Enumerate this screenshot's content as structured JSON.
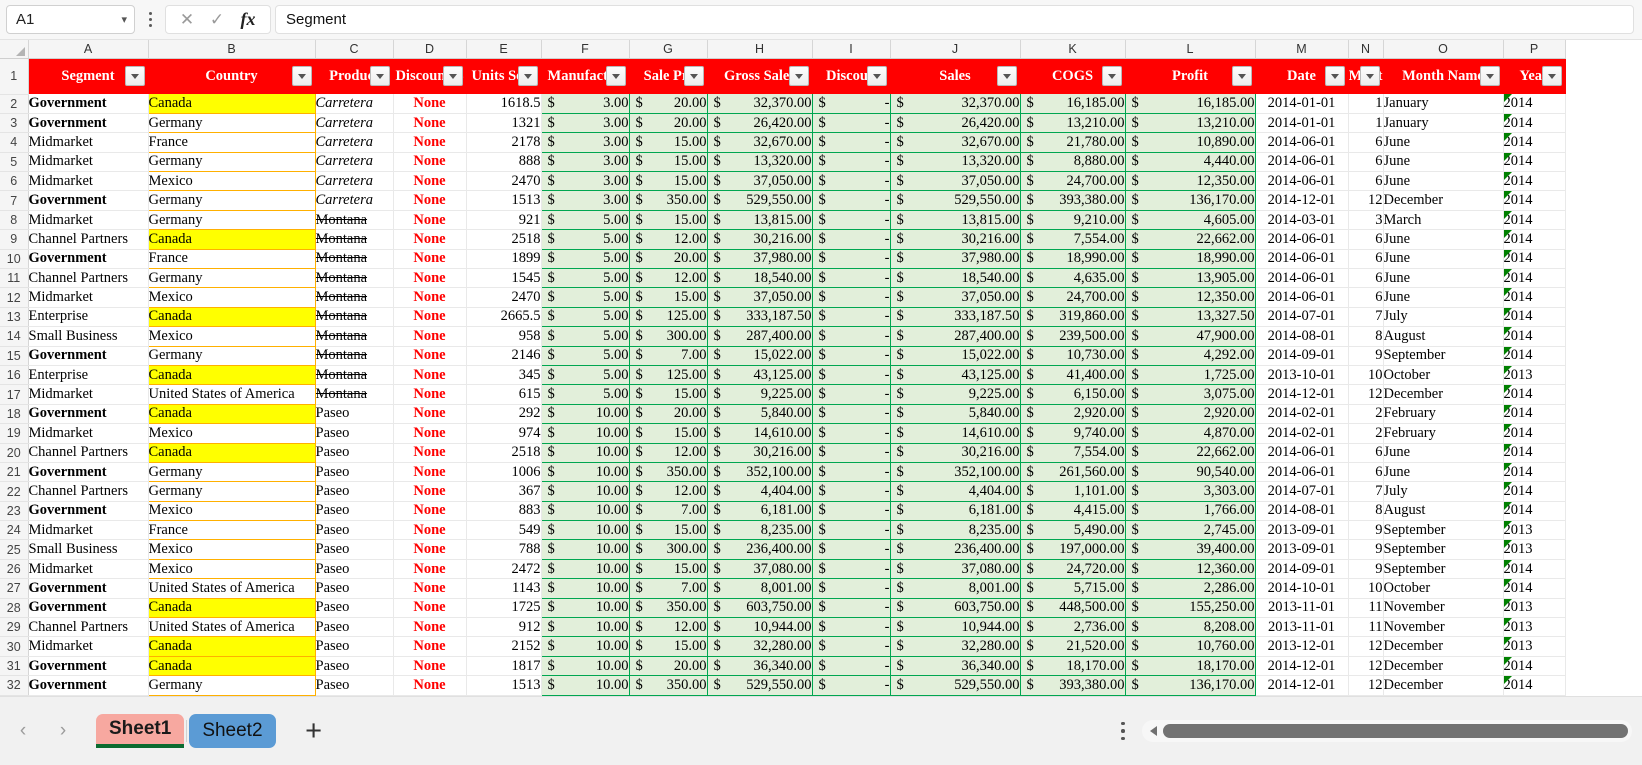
{
  "toolbar": {
    "namebox_value": "A1",
    "namebox_caret": "˅",
    "cancel_icon": "✕",
    "confirm_icon": "✓",
    "fx_label": "fx",
    "formula_value": "Segment"
  },
  "grid": {
    "column_letters": [
      "A",
      "B",
      "C",
      "D",
      "E",
      "F",
      "G",
      "H",
      "I",
      "J",
      "K",
      "L",
      "M",
      "N",
      "O",
      "P"
    ],
    "headers": [
      "Segment",
      "Country",
      "Product",
      "Discount B",
      "Units Sold",
      "Manufactur",
      "Sale Pri",
      "Gross Sales",
      "Discoun",
      "Sales",
      "COGS",
      "Profit",
      "Date",
      "Mont",
      "Month Name",
      "Year"
    ],
    "row_numbers": [
      1,
      2,
      3,
      4,
      5,
      6,
      7,
      8,
      9,
      10,
      11,
      12,
      13,
      14,
      15,
      16,
      17,
      18,
      19,
      20,
      21,
      22,
      23,
      24,
      25,
      26,
      27,
      28,
      29,
      30,
      31,
      32
    ],
    "currency_symbol": "$",
    "dash": "-",
    "rows": [
      {
        "n": 2,
        "segment": "Government",
        "country": "Canada",
        "product": "Carretera",
        "discount": "None",
        "units": "1618.5",
        "mfg": "3.00",
        "sale": "20.00",
        "gross": "32,370.00",
        "disc": "-",
        "sales": "32,370.00",
        "cogs": "16,185.00",
        "profit": "16,185.00",
        "date": "2014-01-01",
        "month": "1",
        "monthname": "January",
        "year": "2014"
      },
      {
        "n": 3,
        "segment": "Government",
        "country": "Germany",
        "product": "Carretera",
        "discount": "None",
        "units": "1321",
        "mfg": "3.00",
        "sale": "20.00",
        "gross": "26,420.00",
        "disc": "-",
        "sales": "26,420.00",
        "cogs": "13,210.00",
        "profit": "13,210.00",
        "date": "2014-01-01",
        "month": "1",
        "monthname": "January",
        "year": "2014"
      },
      {
        "n": 4,
        "segment": "Midmarket",
        "country": "France",
        "product": "Carretera",
        "discount": "None",
        "units": "2178",
        "mfg": "3.00",
        "sale": "15.00",
        "gross": "32,670.00",
        "disc": "-",
        "sales": "32,670.00",
        "cogs": "21,780.00",
        "profit": "10,890.00",
        "date": "2014-06-01",
        "month": "6",
        "monthname": "June",
        "year": "2014"
      },
      {
        "n": 5,
        "segment": "Midmarket",
        "country": "Germany",
        "product": "Carretera",
        "discount": "None",
        "units": "888",
        "mfg": "3.00",
        "sale": "15.00",
        "gross": "13,320.00",
        "disc": "-",
        "sales": "13,320.00",
        "cogs": "8,880.00",
        "profit": "4,440.00",
        "date": "2014-06-01",
        "month": "6",
        "monthname": "June",
        "year": "2014"
      },
      {
        "n": 6,
        "segment": "Midmarket",
        "country": "Mexico",
        "product": "Carretera",
        "discount": "None",
        "units": "2470",
        "mfg": "3.00",
        "sale": "15.00",
        "gross": "37,050.00",
        "disc": "-",
        "sales": "37,050.00",
        "cogs": "24,700.00",
        "profit": "12,350.00",
        "date": "2014-06-01",
        "month": "6",
        "monthname": "June",
        "year": "2014"
      },
      {
        "n": 7,
        "segment": "Government",
        "country": "Germany",
        "product": "Carretera",
        "discount": "None",
        "units": "1513",
        "mfg": "3.00",
        "sale": "350.00",
        "gross": "529,550.00",
        "disc": "-",
        "sales": "529,550.00",
        "cogs": "393,380.00",
        "profit": "136,170.00",
        "date": "2014-12-01",
        "month": "12",
        "monthname": "December",
        "year": "2014"
      },
      {
        "n": 8,
        "segment": "Midmarket",
        "country": "Germany",
        "product": "Montana",
        "discount": "None",
        "units": "921",
        "mfg": "5.00",
        "sale": "15.00",
        "gross": "13,815.00",
        "disc": "-",
        "sales": "13,815.00",
        "cogs": "9,210.00",
        "profit": "4,605.00",
        "date": "2014-03-01",
        "month": "3",
        "monthname": "March",
        "year": "2014"
      },
      {
        "n": 9,
        "segment": "Channel Partners",
        "country": "Canada",
        "product": "Montana",
        "discount": "None",
        "units": "2518",
        "mfg": "5.00",
        "sale": "12.00",
        "gross": "30,216.00",
        "disc": "-",
        "sales": "30,216.00",
        "cogs": "7,554.00",
        "profit": "22,662.00",
        "date": "2014-06-01",
        "month": "6",
        "monthname": "June",
        "year": "2014"
      },
      {
        "n": 10,
        "segment": "Government",
        "country": "France",
        "product": "Montana",
        "discount": "None",
        "units": "1899",
        "mfg": "5.00",
        "sale": "20.00",
        "gross": "37,980.00",
        "disc": "-",
        "sales": "37,980.00",
        "cogs": "18,990.00",
        "profit": "18,990.00",
        "date": "2014-06-01",
        "month": "6",
        "monthname": "June",
        "year": "2014"
      },
      {
        "n": 11,
        "segment": "Channel Partners",
        "country": "Germany",
        "product": "Montana",
        "discount": "None",
        "units": "1545",
        "mfg": "5.00",
        "sale": "12.00",
        "gross": "18,540.00",
        "disc": "-",
        "sales": "18,540.00",
        "cogs": "4,635.00",
        "profit": "13,905.00",
        "date": "2014-06-01",
        "month": "6",
        "monthname": "June",
        "year": "2014"
      },
      {
        "n": 12,
        "segment": "Midmarket",
        "country": "Mexico",
        "product": "Montana",
        "discount": "None",
        "units": "2470",
        "mfg": "5.00",
        "sale": "15.00",
        "gross": "37,050.00",
        "disc": "-",
        "sales": "37,050.00",
        "cogs": "24,700.00",
        "profit": "12,350.00",
        "date": "2014-06-01",
        "month": "6",
        "monthname": "June",
        "year": "2014"
      },
      {
        "n": 13,
        "segment": "Enterprise",
        "country": "Canada",
        "product": "Montana",
        "discount": "None",
        "units": "2665.5",
        "mfg": "5.00",
        "sale": "125.00",
        "gross": "333,187.50",
        "disc": "-",
        "sales": "333,187.50",
        "cogs": "319,860.00",
        "profit": "13,327.50",
        "date": "2014-07-01",
        "month": "7",
        "monthname": "July",
        "year": "2014"
      },
      {
        "n": 14,
        "segment": "Small Business",
        "country": "Mexico",
        "product": "Montana",
        "discount": "None",
        "units": "958",
        "mfg": "5.00",
        "sale": "300.00",
        "gross": "287,400.00",
        "disc": "-",
        "sales": "287,400.00",
        "cogs": "239,500.00",
        "profit": "47,900.00",
        "date": "2014-08-01",
        "month": "8",
        "monthname": "August",
        "year": "2014"
      },
      {
        "n": 15,
        "segment": "Government",
        "country": "Germany",
        "product": "Montana",
        "discount": "None",
        "units": "2146",
        "mfg": "5.00",
        "sale": "7.00",
        "gross": "15,022.00",
        "disc": "-",
        "sales": "15,022.00",
        "cogs": "10,730.00",
        "profit": "4,292.00",
        "date": "2014-09-01",
        "month": "9",
        "monthname": "September",
        "year": "2014"
      },
      {
        "n": 16,
        "segment": "Enterprise",
        "country": "Canada",
        "product": "Montana",
        "discount": "None",
        "units": "345",
        "mfg": "5.00",
        "sale": "125.00",
        "gross": "43,125.00",
        "disc": "-",
        "sales": "43,125.00",
        "cogs": "41,400.00",
        "profit": "1,725.00",
        "date": "2013-10-01",
        "month": "10",
        "monthname": "October",
        "year": "2013"
      },
      {
        "n": 17,
        "segment": "Midmarket",
        "country": "United States of America",
        "product": "Montana",
        "discount": "None",
        "units": "615",
        "mfg": "5.00",
        "sale": "15.00",
        "gross": "9,225.00",
        "disc": "-",
        "sales": "9,225.00",
        "cogs": "6,150.00",
        "profit": "3,075.00",
        "date": "2014-12-01",
        "month": "12",
        "monthname": "December",
        "year": "2014"
      },
      {
        "n": 18,
        "segment": "Government",
        "country": "Canada",
        "product": "Paseo",
        "discount": "None",
        "units": "292",
        "mfg": "10.00",
        "sale": "20.00",
        "gross": "5,840.00",
        "disc": "-",
        "sales": "5,840.00",
        "cogs": "2,920.00",
        "profit": "2,920.00",
        "date": "2014-02-01",
        "month": "2",
        "monthname": "February",
        "year": "2014"
      },
      {
        "n": 19,
        "segment": "Midmarket",
        "country": "Mexico",
        "product": "Paseo",
        "discount": "None",
        "units": "974",
        "mfg": "10.00",
        "sale": "15.00",
        "gross": "14,610.00",
        "disc": "-",
        "sales": "14,610.00",
        "cogs": "9,740.00",
        "profit": "4,870.00",
        "date": "2014-02-01",
        "month": "2",
        "monthname": "February",
        "year": "2014"
      },
      {
        "n": 20,
        "segment": "Channel Partners",
        "country": "Canada",
        "product": "Paseo",
        "discount": "None",
        "units": "2518",
        "mfg": "10.00",
        "sale": "12.00",
        "gross": "30,216.00",
        "disc": "-",
        "sales": "30,216.00",
        "cogs": "7,554.00",
        "profit": "22,662.00",
        "date": "2014-06-01",
        "month": "6",
        "monthname": "June",
        "year": "2014"
      },
      {
        "n": 21,
        "segment": "Government",
        "country": "Germany",
        "product": "Paseo",
        "discount": "None",
        "units": "1006",
        "mfg": "10.00",
        "sale": "350.00",
        "gross": "352,100.00",
        "disc": "-",
        "sales": "352,100.00",
        "cogs": "261,560.00",
        "profit": "90,540.00",
        "date": "2014-06-01",
        "month": "6",
        "monthname": "June",
        "year": "2014"
      },
      {
        "n": 22,
        "segment": "Channel Partners",
        "country": "Germany",
        "product": "Paseo",
        "discount": "None",
        "units": "367",
        "mfg": "10.00",
        "sale": "12.00",
        "gross": "4,404.00",
        "disc": "-",
        "sales": "4,404.00",
        "cogs": "1,101.00",
        "profit": "3,303.00",
        "date": "2014-07-01",
        "month": "7",
        "monthname": "July",
        "year": "2014"
      },
      {
        "n": 23,
        "segment": "Government",
        "country": "Mexico",
        "product": "Paseo",
        "discount": "None",
        "units": "883",
        "mfg": "10.00",
        "sale": "7.00",
        "gross": "6,181.00",
        "disc": "-",
        "sales": "6,181.00",
        "cogs": "4,415.00",
        "profit": "1,766.00",
        "date": "2014-08-01",
        "month": "8",
        "monthname": "August",
        "year": "2014"
      },
      {
        "n": 24,
        "segment": "Midmarket",
        "country": "France",
        "product": "Paseo",
        "discount": "None",
        "units": "549",
        "mfg": "10.00",
        "sale": "15.00",
        "gross": "8,235.00",
        "disc": "-",
        "sales": "8,235.00",
        "cogs": "5,490.00",
        "profit": "2,745.00",
        "date": "2013-09-01",
        "month": "9",
        "monthname": "September",
        "year": "2013"
      },
      {
        "n": 25,
        "segment": "Small Business",
        "country": "Mexico",
        "product": "Paseo",
        "discount": "None",
        "units": "788",
        "mfg": "10.00",
        "sale": "300.00",
        "gross": "236,400.00",
        "disc": "-",
        "sales": "236,400.00",
        "cogs": "197,000.00",
        "profit": "39,400.00",
        "date": "2013-09-01",
        "month": "9",
        "monthname": "September",
        "year": "2013"
      },
      {
        "n": 26,
        "segment": "Midmarket",
        "country": "Mexico",
        "product": "Paseo",
        "discount": "None",
        "units": "2472",
        "mfg": "10.00",
        "sale": "15.00",
        "gross": "37,080.00",
        "disc": "-",
        "sales": "37,080.00",
        "cogs": "24,720.00",
        "profit": "12,360.00",
        "date": "2014-09-01",
        "month": "9",
        "monthname": "September",
        "year": "2014"
      },
      {
        "n": 27,
        "segment": "Government",
        "country": "United States of America",
        "product": "Paseo",
        "discount": "None",
        "units": "1143",
        "mfg": "10.00",
        "sale": "7.00",
        "gross": "8,001.00",
        "disc": "-",
        "sales": "8,001.00",
        "cogs": "5,715.00",
        "profit": "2,286.00",
        "date": "2014-10-01",
        "month": "10",
        "monthname": "October",
        "year": "2014"
      },
      {
        "n": 28,
        "segment": "Government",
        "country": "Canada",
        "product": "Paseo",
        "discount": "None",
        "units": "1725",
        "mfg": "10.00",
        "sale": "350.00",
        "gross": "603,750.00",
        "disc": "-",
        "sales": "603,750.00",
        "cogs": "448,500.00",
        "profit": "155,250.00",
        "date": "2013-11-01",
        "month": "11",
        "monthname": "November",
        "year": "2013"
      },
      {
        "n": 29,
        "segment": "Channel Partners",
        "country": "United States of America",
        "product": "Paseo",
        "discount": "None",
        "units": "912",
        "mfg": "10.00",
        "sale": "12.00",
        "gross": "10,944.00",
        "disc": "-",
        "sales": "10,944.00",
        "cogs": "2,736.00",
        "profit": "8,208.00",
        "date": "2013-11-01",
        "month": "11",
        "monthname": "November",
        "year": "2013"
      },
      {
        "n": 30,
        "segment": "Midmarket",
        "country": "Canada",
        "product": "Paseo",
        "discount": "None",
        "units": "2152",
        "mfg": "10.00",
        "sale": "15.00",
        "gross": "32,280.00",
        "disc": "-",
        "sales": "32,280.00",
        "cogs": "21,520.00",
        "profit": "10,760.00",
        "date": "2013-12-01",
        "month": "12",
        "monthname": "December",
        "year": "2013"
      },
      {
        "n": 31,
        "segment": "Government",
        "country": "Canada",
        "product": "Paseo",
        "discount": "None",
        "units": "1817",
        "mfg": "10.00",
        "sale": "20.00",
        "gross": "36,340.00",
        "disc": "-",
        "sales": "36,340.00",
        "cogs": "18,170.00",
        "profit": "18,170.00",
        "date": "2014-12-01",
        "month": "12",
        "monthname": "December",
        "year": "2014"
      },
      {
        "n": 32,
        "segment": "Government",
        "country": "Germany",
        "product": "Paseo",
        "discount": "None",
        "units": "1513",
        "mfg": "10.00",
        "sale": "350.00",
        "gross": "529,550.00",
        "disc": "-",
        "sales": "529,550.00",
        "cogs": "393,380.00",
        "profit": "136,170.00",
        "date": "2014-12-01",
        "month": "12",
        "monthname": "December",
        "year": "2014"
      }
    ],
    "bold_segments": [
      "Government"
    ],
    "highlight_country": "Canada",
    "italic_products": [
      "Carretera"
    ],
    "strike_products": [
      "Montana"
    ],
    "colors": {
      "header_bg": "#ff0000",
      "header_text": "#ffffff",
      "highlight_yellow": "#ffff00",
      "country_border": "#ffb000",
      "money_bg": "#e2efda",
      "money_border": "#00a650",
      "discount_text": "#ff0000",
      "error_triangle": "#008000"
    }
  },
  "bottom": {
    "prev_icon": "‹",
    "next_icon": "›",
    "tabs": [
      {
        "label": "Sheet1",
        "active": true
      },
      {
        "label": "Sheet2",
        "active": false
      }
    ],
    "add_sheet_icon": "+",
    "active_tab_color": "#f7a8a0",
    "other_tab_color": "#5b9bd5"
  }
}
